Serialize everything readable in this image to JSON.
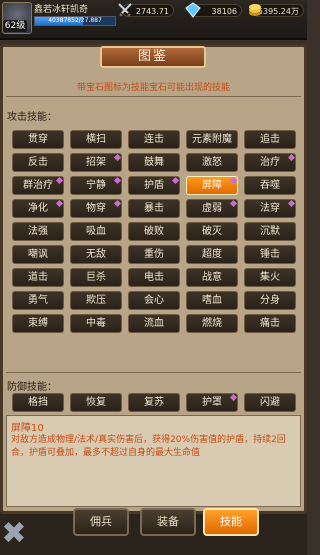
{
  "player": {
    "level": "62级",
    "name": "鑫若冰轩凯奇",
    "exp_text": "40387852/27.887"
  },
  "resources": {
    "power": "2743.71",
    "gems": "38106",
    "gold": "5395.24万"
  },
  "panel": {
    "title": "图鉴",
    "subtitle": "带宝石图标为技能宝石可能出现的技能",
    "attack_label": "攻击技能：",
    "defense_label": "防御技能："
  },
  "attack_skills": [
    {
      "name": "贯穿",
      "gem": false,
      "active": false
    },
    {
      "name": "横扫",
      "gem": false,
      "active": false
    },
    {
      "name": "连击",
      "gem": false,
      "active": false
    },
    {
      "name": "元素附魔",
      "gem": false,
      "active": false
    },
    {
      "name": "追击",
      "gem": false,
      "active": false
    },
    {
      "name": "反击",
      "gem": false,
      "active": false
    },
    {
      "name": "招架",
      "gem": true,
      "active": false
    },
    {
      "name": "鼓舞",
      "gem": false,
      "active": false
    },
    {
      "name": "激怒",
      "gem": false,
      "active": false
    },
    {
      "name": "治疗",
      "gem": true,
      "active": false
    },
    {
      "name": "群治疗",
      "gem": true,
      "active": false
    },
    {
      "name": "宁静",
      "gem": true,
      "active": false
    },
    {
      "name": "护盾",
      "gem": true,
      "active": false
    },
    {
      "name": "屏障",
      "gem": true,
      "active": true
    },
    {
      "name": "吞噬",
      "gem": false,
      "active": false
    },
    {
      "name": "净化",
      "gem": true,
      "active": false
    },
    {
      "name": "物穿",
      "gem": true,
      "active": false
    },
    {
      "name": "暴击",
      "gem": false,
      "active": false
    },
    {
      "name": "虚弱",
      "gem": true,
      "active": false
    },
    {
      "name": "法穿",
      "gem": true,
      "active": false
    },
    {
      "name": "法强",
      "gem": false,
      "active": false
    },
    {
      "name": "吸血",
      "gem": false,
      "active": false
    },
    {
      "name": "破败",
      "gem": false,
      "active": false
    },
    {
      "name": "破灭",
      "gem": false,
      "active": false
    },
    {
      "name": "沉默",
      "gem": false,
      "active": false
    },
    {
      "name": "嘲讽",
      "gem": false,
      "active": false
    },
    {
      "name": "无敌",
      "gem": false,
      "active": false
    },
    {
      "name": "重伤",
      "gem": false,
      "active": false
    },
    {
      "name": "超度",
      "gem": false,
      "active": false
    },
    {
      "name": "锤击",
      "gem": false,
      "active": false
    },
    {
      "name": "道击",
      "gem": false,
      "active": false
    },
    {
      "name": "巨杀",
      "gem": false,
      "active": false
    },
    {
      "name": "电击",
      "gem": false,
      "active": false
    },
    {
      "name": "战意",
      "gem": false,
      "active": false
    },
    {
      "name": "集火",
      "gem": false,
      "active": false
    },
    {
      "name": "勇气",
      "gem": false,
      "active": false
    },
    {
      "name": "欺压",
      "gem": false,
      "active": false
    },
    {
      "name": "会心",
      "gem": false,
      "active": false
    },
    {
      "name": "嗜血",
      "gem": false,
      "active": false
    },
    {
      "name": "分身",
      "gem": false,
      "active": false
    },
    {
      "name": "束缚",
      "gem": false,
      "active": false
    },
    {
      "name": "中毒",
      "gem": false,
      "active": false
    },
    {
      "name": "流血",
      "gem": false,
      "active": false
    },
    {
      "name": "燃烧",
      "gem": false,
      "active": false
    },
    {
      "name": "痛击",
      "gem": false,
      "active": false
    }
  ],
  "defense_skills": [
    {
      "name": "格挡",
      "gem": false,
      "active": false
    },
    {
      "name": "恢复",
      "gem": false,
      "active": false
    },
    {
      "name": "复苏",
      "gem": false,
      "active": false
    },
    {
      "name": "护罩",
      "gem": true,
      "active": false
    },
    {
      "name": "闪避",
      "gem": false,
      "active": false
    }
  ],
  "description": {
    "title": "屏障10",
    "text": "对敌方造成物理/法术/真实伤害后，获得20%伤害值的护盾，持续2回合，护盾可叠加，最多不超过自身的最大生命值"
  },
  "tabs": [
    "佣兵",
    "装备",
    "技能"
  ],
  "active_tab": 2
}
